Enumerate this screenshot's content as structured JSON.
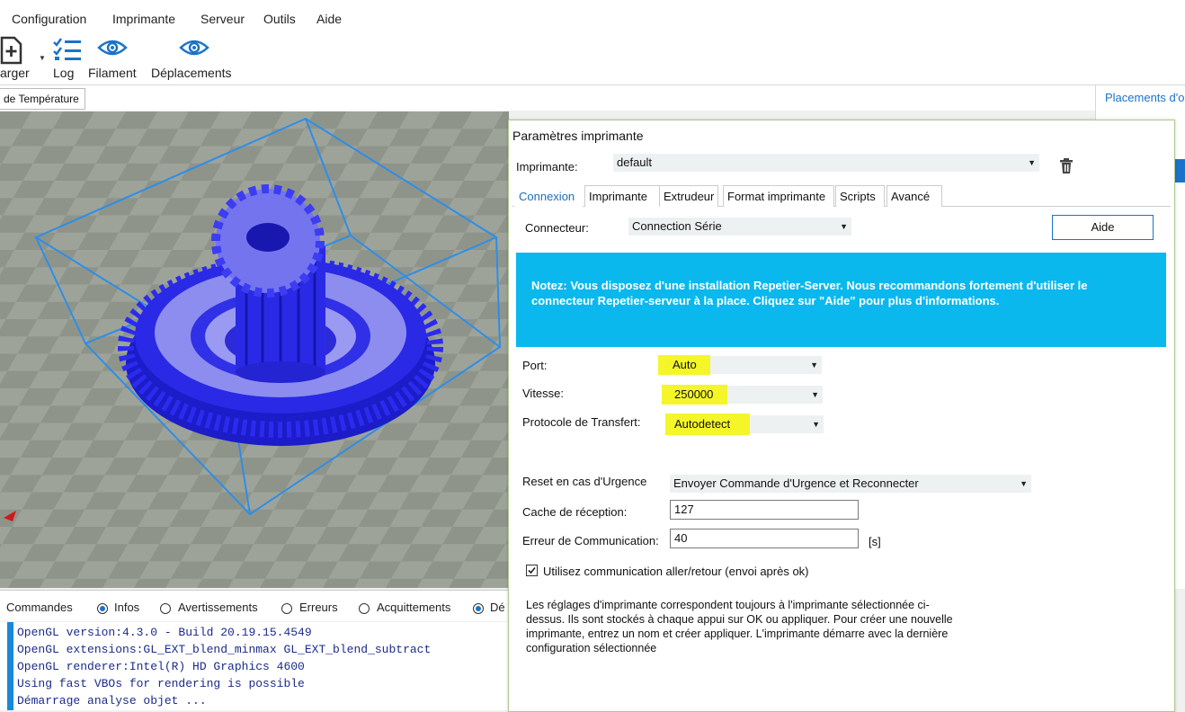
{
  "menu": [
    "Configuration",
    "Imprimante",
    "Serveur",
    "Outils",
    "Aide"
  ],
  "toolbar": {
    "charger": "arger",
    "log": "Log",
    "filament": "Filament",
    "deplacements": "Déplacements"
  },
  "tabs_main": {
    "temperature": "de Température"
  },
  "right_panel": {
    "placements": "Placements d'o"
  },
  "log": {
    "filters": [
      "Commandes",
      "Infos",
      "Avertissements",
      "Erreurs",
      "Acquittements",
      "Dé"
    ],
    "lines": [
      "OpenGL version:4.3.0 - Build 20.19.15.4549",
      "OpenGL extensions:GL_EXT_blend_minmax GL_EXT_blend_subtract",
      "OpenGL renderer:Intel(R) HD Graphics 4600",
      "Using fast VBOs for rendering is possible",
      "Démarrage analyse objet ..."
    ]
  },
  "dialog": {
    "title": "Paramètres imprimante",
    "printer_label": "Imprimante:",
    "printer_value": "default",
    "tabs": [
      "Connexion",
      "Imprimante",
      "Extrudeur",
      "Format imprimante",
      "Scripts",
      "Avancé"
    ],
    "connector_label": "Connecteur:",
    "connector_value": "Connection Série",
    "help_button": "Aide",
    "notice": "Notez: Vous disposez d'une installation Repetier-Server. Nous recommandons fortement d'utiliser le connecteur Repetier-serveur à la place. Cliquez sur \"Aide\" pour plus d'informations.",
    "port_label": "Port:",
    "port_value": "Auto",
    "speed_label": "Vitesse:",
    "speed_value": "250000",
    "protocol_label": "Protocole de Transfert:",
    "protocol_value": "Autodetect",
    "reset_label": "Reset en cas d'Urgence",
    "reset_value": "Envoyer Commande d'Urgence et Reconnecter",
    "cache_label": "Cache de réception:",
    "cache_value": "127",
    "error_label": "Erreur de Communication:",
    "error_value": "40",
    "error_unit": "[s]",
    "pingpong_label": "Utilisez communication aller/retour (envoi après ok)",
    "info_text": "Les réglages d'imprimante correspondent toujours à l'imprimante sélectionnée ci-dessus. Ils sont stockés à chaque appui sur OK ou appliquer. Pour créer une nouvelle imprimante, entrez un nom et créer appliquer. L'imprimante démarre avec la dernière configuration sélectionnée"
  },
  "colors": {
    "accent": "#1a73c8",
    "notice_bg": "#0ab8ee",
    "highlight": "#f4f62a",
    "gear": "#2323e8"
  }
}
